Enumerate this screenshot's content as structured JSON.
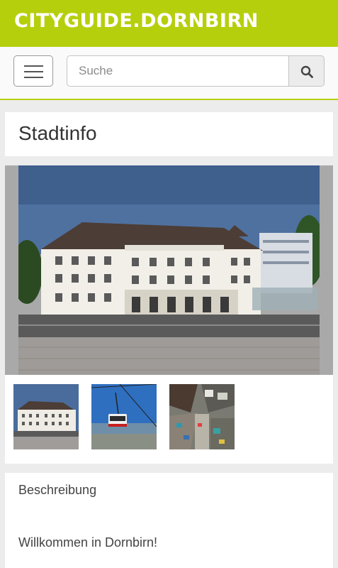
{
  "brand": {
    "logo_text": "CITYGUIDE.DORNBIRN",
    "color": "#b6cf0d"
  },
  "nav": {
    "search_placeholder": "Suche"
  },
  "page": {
    "title": "Stadtinfo"
  },
  "gallery": {
    "main_image": "town-hall-photo",
    "thumbnails": [
      "town-hall-thumbnail",
      "cable-car-thumbnail",
      "aerial-market-thumbnail"
    ]
  },
  "description": {
    "heading": "Beschreibung",
    "text": "Willkommen in Dornbirn!"
  }
}
